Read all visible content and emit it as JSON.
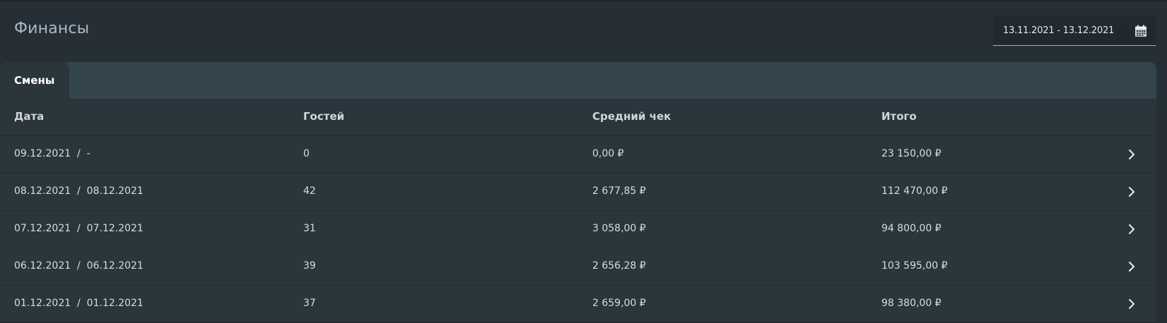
{
  "page": {
    "title": "Финансы"
  },
  "date_range": {
    "value": "13.11.2021 - 13.12.2021",
    "icon": "calendar-icon"
  },
  "tabs": [
    {
      "label": "Смены",
      "active": true
    }
  ],
  "table": {
    "columns": [
      "Дата",
      "Гостей",
      "Средний чек",
      "Итого"
    ],
    "rows": [
      {
        "date": "09.12.2021  /  -",
        "guests": "0",
        "avg_check": "0,00 ₽",
        "total": "23 150,00 ₽"
      },
      {
        "date": "08.12.2021  /  08.12.2021",
        "guests": "42",
        "avg_check": "2 677,85 ₽",
        "total": "112 470,00 ₽"
      },
      {
        "date": "07.12.2021  /  07.12.2021",
        "guests": "31",
        "avg_check": "3 058,00 ₽",
        "total": "94 800,00 ₽"
      },
      {
        "date": "06.12.2021  /  06.12.2021",
        "guests": "39",
        "avg_check": "2 656,28 ₽",
        "total": "103 595,00 ₽"
      },
      {
        "date": "01.12.2021  /  01.12.2021",
        "guests": "37",
        "avg_check": "2 659,00 ₽",
        "total": "98 380,00 ₽"
      }
    ],
    "row_icon": "chevron-right-icon"
  },
  "colors": {
    "background": "#262f35",
    "card": "#2b353c",
    "tabs_bar": "#34454e",
    "title": "#aab9c3"
  }
}
